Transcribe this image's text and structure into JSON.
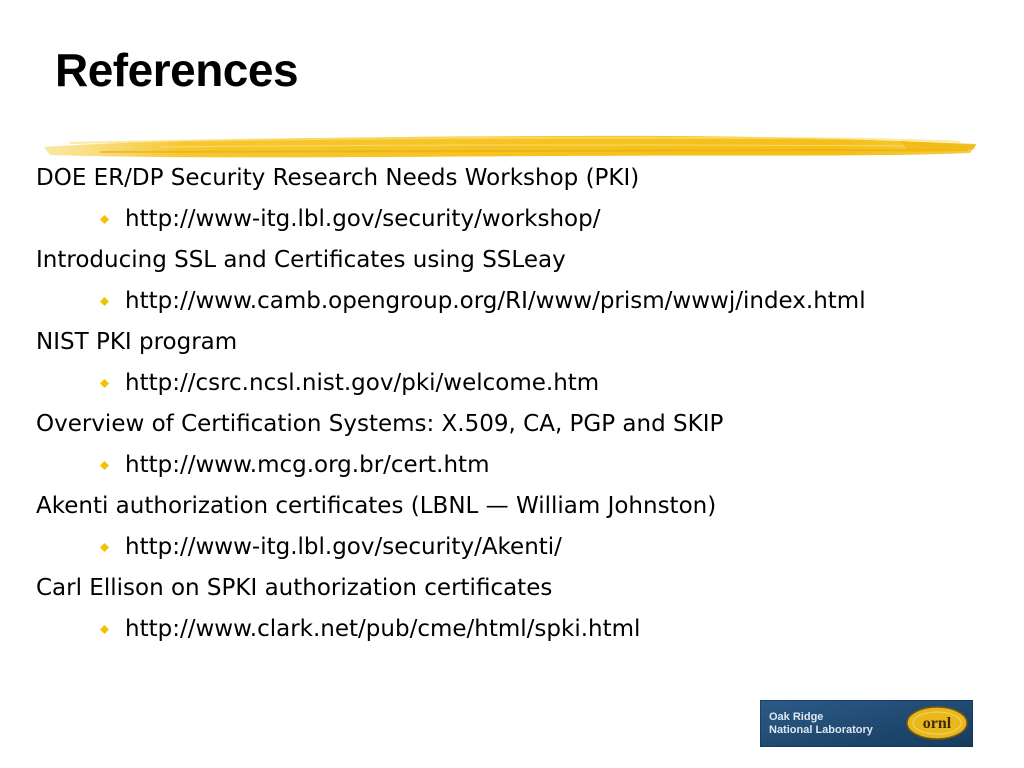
{
  "slide": {
    "title": "References"
  },
  "references": [
    {
      "topic": "DOE ER/DP Security Research Needs Workshop (PKI)",
      "url": "http://www-itg.lbl.gov/security/workshop/"
    },
    {
      "topic": "Introducing SSL and Certificates using SSLeay",
      "url": "http://www.camb.opengroup.org/RI/www/prism/wwwj/index.html"
    },
    {
      "topic": "NIST PKI program",
      "url": "http://csrc.ncsl.nist.gov/pki/welcome.htm"
    },
    {
      "topic": "Overview of Certification Systems: X.509, CA, PGP and SKIP",
      "url": "http://www.mcg.org.br/cert.htm"
    },
    {
      "topic": "Akenti authorization certificates (LBNL — William Johnston)",
      "url": "http://www-itg.lbl.gov/security/Akenti/"
    },
    {
      "topic": "Carl Ellison on SPKI authorization certificates",
      "url": "http://www.clark.net/pub/cme/html/spki.html"
    }
  ],
  "logo": {
    "line1": "Oak Ridge",
    "line2": "National Laboratory",
    "mark": "ornl"
  },
  "colors": {
    "bullet": "#f2c200",
    "underline": "#f5c21b",
    "logo_bg": "#1f4a73",
    "logo_mark": "#e8b81c"
  },
  "icons": {
    "bullet": "diamond-bullet-icon",
    "title_decoration": "yellow-brushstroke"
  }
}
